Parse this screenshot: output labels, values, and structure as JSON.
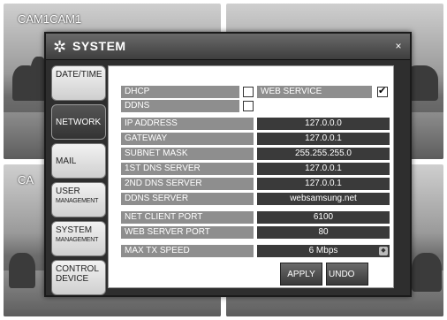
{
  "camera_labels": {
    "top_left": "CAM1CAM1",
    "mid_left": "CA"
  },
  "dialog": {
    "title": "SYSTEM",
    "close_glyph": "×",
    "title_icon": "gear-icon"
  },
  "tabs": [
    {
      "label": "DATE/TIME",
      "active": false
    },
    {
      "label": "NETWORK",
      "active": true
    },
    {
      "label": "MAIL",
      "active": false
    },
    {
      "label": "USER",
      "sub": "MANAGEMENT",
      "active": false
    },
    {
      "label": "SYSTEM",
      "sub": "MANAGEMENT",
      "active": false
    },
    {
      "label": "CONTROL",
      "sub": "DEVICE",
      "active": false
    }
  ],
  "network": {
    "dhcp_label": "DHCP",
    "dhcp_checked": false,
    "ddns_label": "DDNS",
    "ddns_checked": false,
    "web_service_label": "WEB SERVICE",
    "web_service_checked": true,
    "fields": [
      {
        "label": "IP ADDRESS",
        "value": "127.0.0.0"
      },
      {
        "label": "GATEWAY",
        "value": "127.0.0.1"
      },
      {
        "label": "SUBNET MASK",
        "value": "255.255.255.0"
      },
      {
        "label": "1ST DNS SERVER",
        "value": "127.0.0.1"
      },
      {
        "label": "2ND DNS SERVER",
        "value": "127.0.0.1"
      },
      {
        "label": "DDNS SERVER",
        "value": "websamsung.net"
      }
    ],
    "ports": [
      {
        "label": "NET CLIENT PORT",
        "value": "6100"
      },
      {
        "label": "WEB SERVER PORT",
        "value": "80"
      }
    ],
    "max_tx": {
      "label": "MAX TX SPEED",
      "value": "6 Mbps"
    }
  },
  "buttons": {
    "apply": "APPLY",
    "undo": "UNDO"
  },
  "colors": {
    "label_bg": "#8e8e8e",
    "value_bg": "#3a3a3a",
    "dialog_bg": "#2e2e2e"
  }
}
